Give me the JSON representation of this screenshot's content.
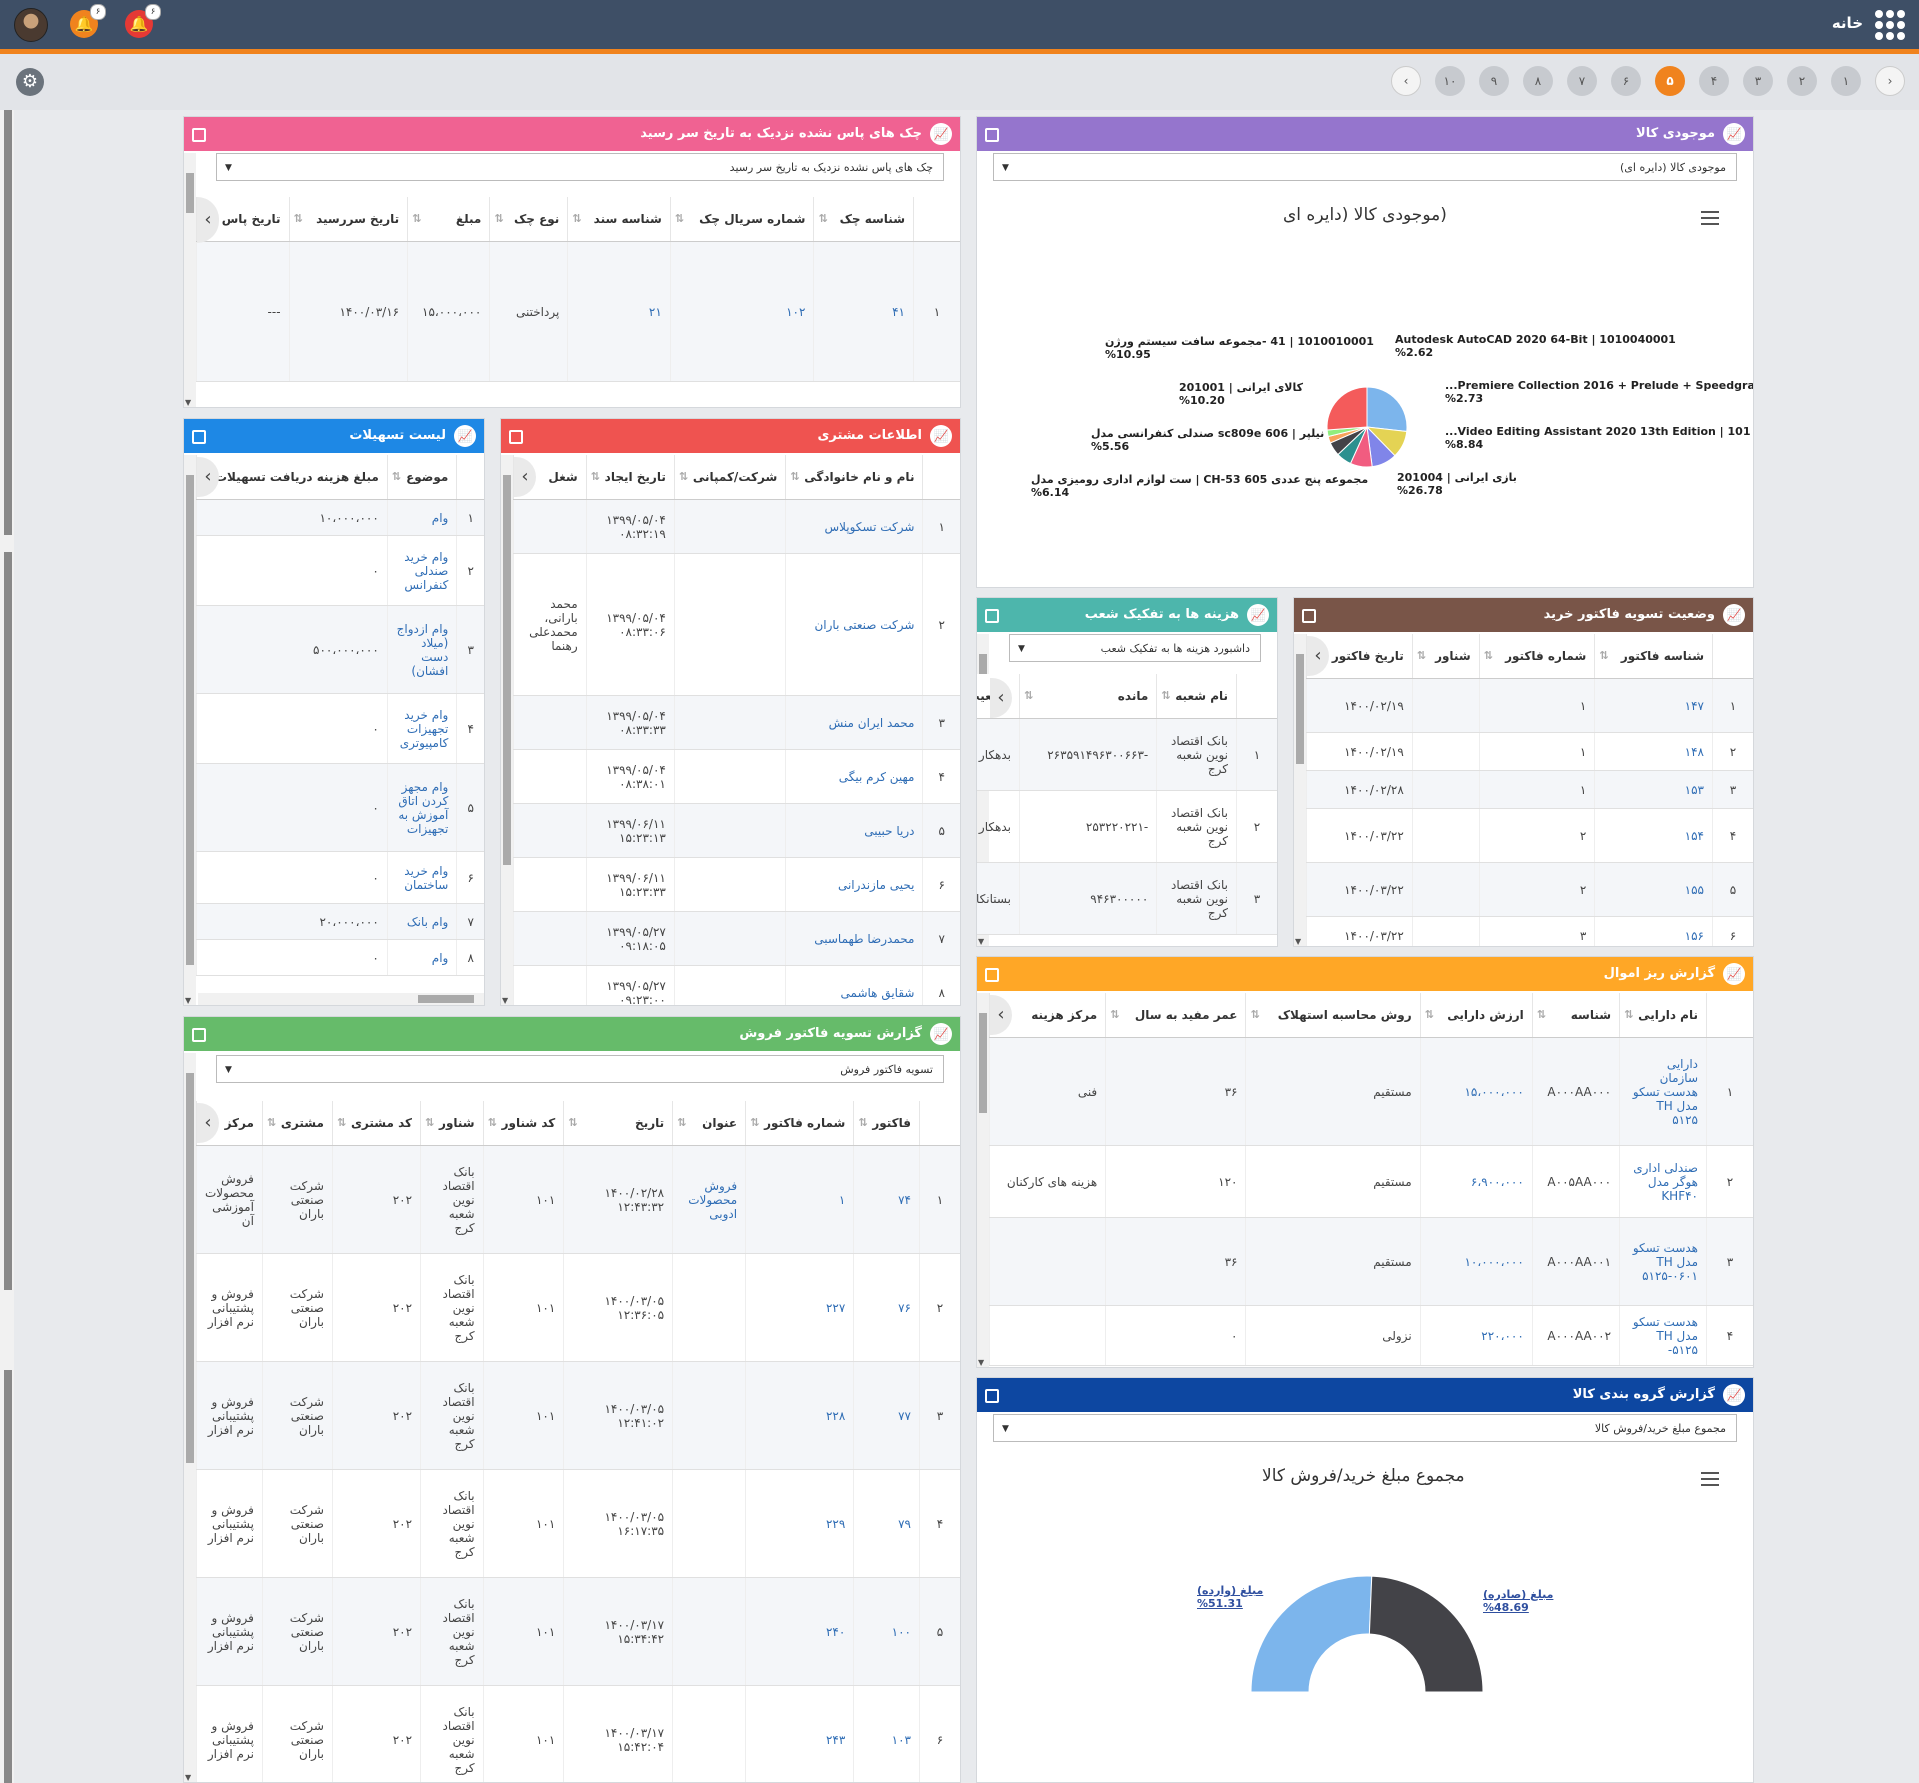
{
  "topbar": {
    "home": "خانه",
    "badge_orange": "۶",
    "badge_red": "۶"
  },
  "pager": {
    "pages": [
      "۱",
      "۲",
      "۳",
      "۴",
      "۵",
      "۶",
      "۷",
      "۸",
      "۹",
      "۱۰"
    ],
    "active": "۵"
  },
  "colors": {
    "pink": "#f06292",
    "purple": "#9575cd",
    "red": "#ef5350",
    "blue": "#1e88e5",
    "teal": "#4db6ac",
    "brown": "#795548",
    "green": "#66bb6a",
    "orange": "#ffa726",
    "navy": "#0d47a1",
    "accent": "#f0831e"
  },
  "checks": {
    "title": "چک های پاس نشده نزدیک به تاریخ سر رسید",
    "dropdown": "چک های پاس نشده نزدیک به تاریخ سر رسید",
    "headers": [
      "شناسه چک",
      "شماره سریال چک",
      "شناسه سند",
      "نوع چک",
      "مبلغ",
      "تاریخ سررسید",
      "تاریخ پاس"
    ],
    "rows": [
      [
        "۱",
        "۴۱",
        "۱۰۲",
        "۲۱",
        "پرداختنی",
        "۱۵،۰۰۰،۰۰۰",
        "۱۴۰۰/۰۳/۱۶",
        "---"
      ]
    ]
  },
  "stock": {
    "title": "موجودی کالا",
    "dropdown": "موجودی کالا (دایره ای)",
    "chart_title": "(موجودی کالا (دایره ای"
  },
  "chart_data": [
    {
      "type": "pie",
      "title": "(موجودی کالا (دایره ای",
      "slices": [
        {
          "label": "بازی ایرانی | 201004",
          "value": 26.78,
          "pct": "%26.78",
          "color": "#7cb5ec"
        },
        {
          "label": "1010010001 | 41 -مجموعه سافت سیستم ورژن",
          "value": 10.95,
          "pct": "%10.95",
          "color": "#e4d354"
        },
        {
          "label": "کالای ایرانی | 201001",
          "value": 10.2,
          "pct": "%10.20",
          "color": "#8085e9"
        },
        {
          "label": "Video Editing Assistant 2020 13th Edition | 101...",
          "value": 8.84,
          "pct": "%8.84",
          "color": "#f15c80"
        },
        {
          "label": "مجموعه پنج عددی CH-53 605 | ست لوازم اداری رومیزی مدل",
          "value": 6.14,
          "pct": "%6.14",
          "color": "#2b908f"
        },
        {
          "label": "نیلپر | sc809e 606 صندلی کنفرانسی مدل",
          "value": 5.56,
          "pct": "%5.56",
          "color": "#434348"
        },
        {
          "label": "Premiere Collection 2016 + Prelude + Speedgra...",
          "value": 2.73,
          "pct": "%2.73",
          "color": "#f7a35c"
        },
        {
          "label": "Autodesk AutoCAD 2020 64-Bit | 1010040001",
          "value": 2.62,
          "pct": "%2.62",
          "color": "#90ed7d"
        },
        {
          "label": "",
          "value": 26.18,
          "pct": "",
          "color": "#f45b5b"
        }
      ]
    },
    {
      "type": "pie",
      "title": "مجموع مبلغ خرید/فروش کالا",
      "slices": [
        {
          "label": "مبلغ (وارده)",
          "value": 51.31,
          "pct": "%51.31",
          "color": "#7cb5ec"
        },
        {
          "label": "مبلغ (صادره)",
          "value": 48.69,
          "pct": "%48.69",
          "color": "#434348"
        }
      ]
    }
  ],
  "facilities": {
    "title": "لیست تسهیلات",
    "headers": [
      "موضوع",
      "مبلغ هزینه دریافت تسهیلات"
    ],
    "rows": [
      [
        "۱",
        "وام",
        "۱۰،۰۰۰،۰۰۰"
      ],
      [
        "۲",
        "وام خرید صندلی کنفرانس",
        "۰"
      ],
      [
        "۳",
        "وام ازدواج (میلاد دست افشان)",
        "۵۰۰،۰۰۰،۰۰۰"
      ],
      [
        "۴",
        "وام خرید تجهیزات کامپیوتری",
        "۰"
      ],
      [
        "۵",
        "وام مجهز کردن اتاق آموزش به تجهیزات",
        "۰"
      ],
      [
        "۶",
        "وام خرید ساختمان",
        "۰"
      ],
      [
        "۷",
        "وام بانک",
        "۲۰،۰۰۰،۰۰۰"
      ],
      [
        "۸",
        "وام",
        "۰"
      ]
    ]
  },
  "customers": {
    "title": "اطلاعات مشتری",
    "headers": [
      "نام و نام خانوادگی",
      "شرکت/کمپانی",
      "تاریخ ایجاد",
      "شغل"
    ],
    "rows": [
      [
        "۱",
        "شرکت تسکوپلاس",
        "",
        "۱۳۹۹/۰۵/۰۴ ۰۸:۳۲:۱۹",
        ""
      ],
      [
        "۲",
        "شرکت صنعتی باران",
        "",
        "۱۳۹۹/۰۵/۰۴ ۰۸:۳۳:۰۶",
        "محمد بارانی، محمدعلی رهنما"
      ],
      [
        "۳",
        "محمد ایران منش",
        "",
        "۱۳۹۹/۰۵/۰۴ ۰۸:۳۳:۳۳",
        ""
      ],
      [
        "۴",
        "مهین کرم بیگی",
        "",
        "۱۳۹۹/۰۵/۰۴ ۰۸:۳۸:۰۱",
        ""
      ],
      [
        "۵",
        "دریا حبیبی",
        "",
        "۱۳۹۹/۰۶/۱۱ ۱۵:۲۳:۱۳",
        ""
      ],
      [
        "۶",
        "یحیی مازندرانی",
        "",
        "۱۳۹۹/۰۶/۱۱ ۱۵:۲۳:۳۳",
        ""
      ],
      [
        "۷",
        "محمدرضا طهماسبی",
        "",
        "۱۳۹۹/۰۵/۲۷ ۰۹:۱۸:۰۵",
        ""
      ],
      [
        "۸",
        "شقایق هاشمی",
        "",
        "۱۳۹۹/۰۵/۲۷ ۰۹:۲۳:۰۰",
        ""
      ]
    ]
  },
  "branch_costs": {
    "title": "هزینه ها به تفکیک شعب",
    "dropdown": "داشبورد هزینه ها به تفکیک شعب",
    "headers": [
      "نام شعبه",
      "مانده",
      "وضعیت"
    ],
    "rows": [
      [
        "۱",
        "بانک اقتصاد نوین شعبه کرج",
        "-۲۶۳۵۹۱۴۹۶۳۰۰۶۶۳",
        "بدهکار"
      ],
      [
        "۲",
        "بانک اقتصاد نوین شعبه کرج",
        "-۲۵۳۲۲۰۲۲۱",
        "بدهکار"
      ],
      [
        "۳",
        "بانک اقتصاد نوین شعبه کرج",
        "۹۴۶۳۰۰۰۰۰",
        "بستانکار"
      ]
    ]
  },
  "purchase_status": {
    "title": "وضعیت تسویه فاکتور خرید",
    "headers": [
      "شناسه فاکتور",
      "شماره فاکتور",
      "شناور",
      "تاریخ فاکتور"
    ],
    "rows": [
      [
        "۱",
        "۱۴۷",
        "۱",
        "",
        "۱۴۰۰/۰۲/۱۹"
      ],
      [
        "۲",
        "۱۴۸",
        "۱",
        "",
        "۱۴۰۰/۰۲/۱۹"
      ],
      [
        "۳",
        "۱۵۳",
        "۱",
        "",
        "۱۴۰۰/۰۲/۲۸"
      ],
      [
        "۴",
        "۱۵۴",
        "۲",
        "",
        "۱۴۰۰/۰۳/۲۲"
      ],
      [
        "۵",
        "۱۵۵",
        "۲",
        "",
        "۱۴۰۰/۰۳/۲۲"
      ],
      [
        "۶",
        "۱۵۶",
        "۳",
        "",
        "۱۴۰۰/۰۳/۲۲"
      ]
    ]
  },
  "assets": {
    "title": "گزارش ریز اموال",
    "headers": [
      "نام دارایی",
      "شناسه",
      "ارزش دارایی",
      "روش محاسبه استهلاک",
      "عمر مفید به سال",
      "مرکز هزینه"
    ],
    "rows": [
      [
        "۱",
        "دارایی سازمان هدست تسکو مدل TH ۵۱۲۵",
        "A۰۰۰AA۰۰۰",
        "۱۵،۰۰۰،۰۰۰",
        "مستقیم",
        "۳۶",
        "فنی"
      ],
      [
        "۲",
        "صندلی اداری هوگر مدل KHF۴۰",
        "A۰۰۵AA۰۰۰",
        "۶،۹۰۰،۰۰۰",
        "مستقیم",
        "۱۲۰",
        "هزینه های کارکنان"
      ],
      [
        "۳",
        "هدست تسکو مدل TH ۵۱۲۵-۰۶۰۱",
        "A۰۰۰AA۰۰۱",
        "۱۰،۰۰۰،۰۰۰",
        "مستقیم",
        "۳۶",
        ""
      ],
      [
        "۴",
        "هدست تسکو مدل TH ۵۱۲۵-",
        "A۰۰۰AA۰۰۲",
        "۲۲۰،۰۰۰",
        "نزولی",
        "۰",
        ""
      ]
    ]
  },
  "sales_settlement": {
    "title": "گزارش تسویه فاکتور فروش",
    "dropdown": "تسویه فاکتور فروش",
    "headers": [
      "فاکتور",
      "شماره فاکتور",
      "عنوان",
      "تاریخ",
      "کد شناور",
      "شناور",
      "کد مشتری",
      "مشتری",
      "مرکز"
    ],
    "rows": [
      [
        "۱",
        "۷۴",
        "۱",
        "فروش محصولات ادوبی",
        "۱۴۰۰/۰۲/۲۸ ۱۲:۴۳:۳۲",
        "۱۰۱",
        "بانک اقتصاد نوین شعبه کرج",
        "۲۰۲",
        "شرکت صنعتی باران",
        "فروش محصولات آموزشی آن"
      ],
      [
        "۲",
        "۷۶",
        "۲۲۷",
        "",
        "۱۴۰۰/۰۳/۰۵ ۱۲:۳۶:۰۵",
        "۱۰۱",
        "بانک اقتصاد نوین شعبه کرج",
        "۲۰۲",
        "شرکت صنعتی باران",
        "فروش و پشتیبانی نرم افزار"
      ],
      [
        "۳",
        "۷۷",
        "۲۲۸",
        "",
        "۱۴۰۰/۰۳/۰۵ ۱۲:۴۱:۰۲",
        "۱۰۱",
        "بانک اقتصاد نوین شعبه کرج",
        "۲۰۲",
        "شرکت صنعتی باران",
        "فروش و پشتیبانی نرم افزار"
      ],
      [
        "۴",
        "۷۹",
        "۲۲۹",
        "",
        "۱۴۰۰/۰۳/۰۵ ۱۶:۱۷:۳۵",
        "۱۰۱",
        "بانک اقتصاد نوین شعبه کرج",
        "۲۰۲",
        "شرکت صنعتی باران",
        "فروش و پشتیبانی نرم افزار"
      ],
      [
        "۵",
        "۱۰۰",
        "۲۴۰",
        "",
        "۱۴۰۰/۰۳/۱۷ ۱۵:۳۴:۴۲",
        "۱۰۱",
        "بانک اقتصاد نوین شعبه کرج",
        "۲۰۲",
        "شرکت صنعتی باران",
        "فروش و پشتیبانی نرم افزار"
      ],
      [
        "۶",
        "۱۰۳",
        "۲۴۳",
        "",
        "۱۴۰۰/۰۳/۱۷ ۱۵:۴۲:۰۴",
        "۱۰۱",
        "بانک اقتصاد نوین شعبه کرج",
        "۲۰۲",
        "شرکت صنعتی باران",
        "فروش و پشتیبانی نرم افزار"
      ]
    ]
  },
  "group_report": {
    "title": "گزارش گروه بندی کالا",
    "dropdown": "مجموع مبلغ خرید/فروش کالا",
    "chart_title": "مجموع مبلغ خرید/فروش کالا"
  }
}
